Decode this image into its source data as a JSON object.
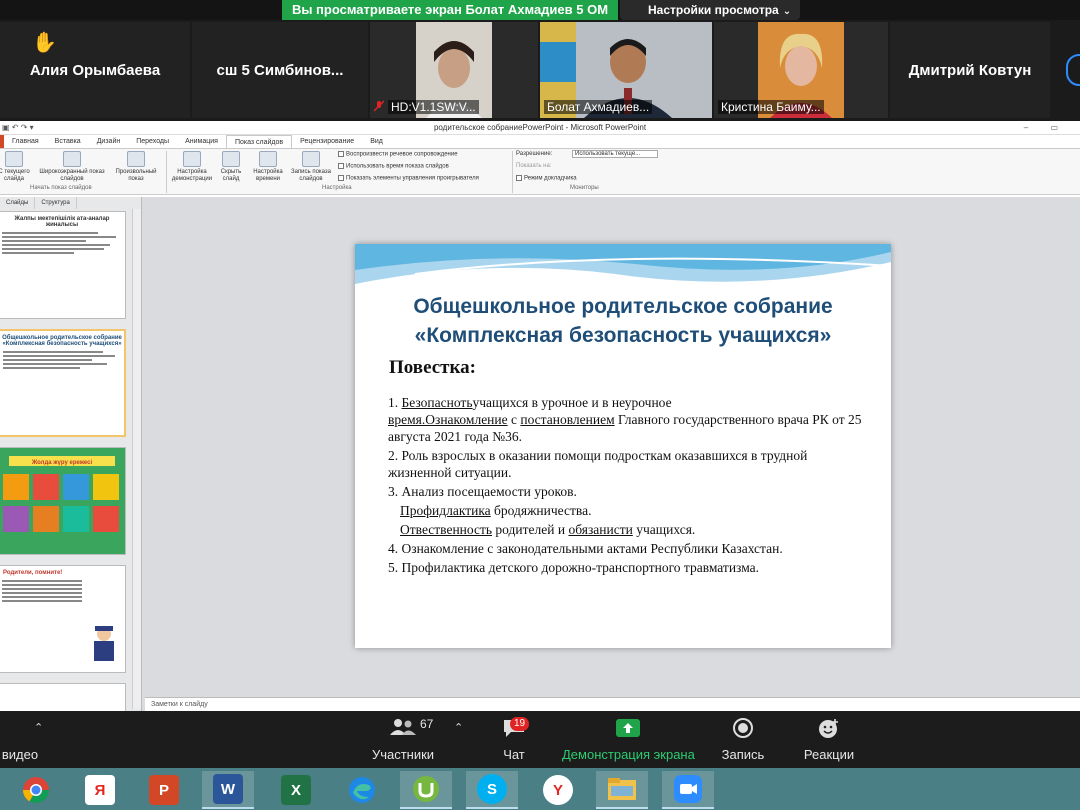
{
  "share_banner": {
    "viewing_text": "Вы просматриваете экран Болат Ахмадиев 5 ОМ",
    "settings_label": "Настройки просмотра"
  },
  "participants": [
    {
      "name": "Алия Орымбаева",
      "raised_hand": true
    },
    {
      "name": "сш 5  Симбинов...",
      "muted": true
    },
    {
      "name": "HD:V1.1SW:V...",
      "muted": true
    },
    {
      "name": "Болат Ахмадиев..."
    },
    {
      "name": "Кристина Баиму..."
    },
    {
      "name": "Дмитрий Ковтун"
    }
  ],
  "powerpoint": {
    "window_title": "родительское собраниePowerPoint - Microsoft PowerPoint",
    "tabs": [
      "Главная",
      "Вставка",
      "Дизайн",
      "Переходы",
      "Анимация",
      "Показ слайдов",
      "Рецензирование",
      "Вид"
    ],
    "active_tab": "Показ слайдов",
    "ribbon": {
      "b1": "С текущего слайда",
      "b2": "Широкоэкранный показ слайдов",
      "b3": "Произвольный показ",
      "group1": "Начать показ слайдов",
      "b4": "Настройка демонстрации",
      "b5": "Скрыть слайд",
      "b6": "Настройка времени",
      "b7": "Запись показа слайдов",
      "chk1": "Воспроизвести речевое сопровождение",
      "chk2": "Использовать время показа слайдов",
      "chk3": "Показать элементы управления проигрывателя",
      "group2": "Настройка",
      "res_label": "Разрешение:",
      "res_value": "Использовать текуще...",
      "show_on": "Показать на:",
      "presenter": "Режим докладчика",
      "group3": "Мониторы"
    },
    "thumb_tabs": [
      "Слайды",
      "Структура"
    ],
    "thumbs": [
      {
        "title": "Жалпы мектепішілік ата-аналар жиналысы"
      },
      {
        "title": "Общешкольное родительское собрание «Комплексная безопасность учащихся»"
      },
      {
        "title": "Жолда жүру ережесі"
      },
      {
        "title": "Родители, помните!"
      }
    ],
    "notes_placeholder": "Заметки к слайду"
  },
  "slide": {
    "title_line1": "Общешкольное родительское собрание",
    "title_line2": "«Комплексная безопасность учащихся»",
    "agenda_heading": "Повестка:",
    "item1_num": "1. ",
    "item1_a": "Безопасноть",
    "item1_b": "учащихся в урочное и в неурочное",
    "item1_c": "время.Ознакомление",
    "item1_d": " с ",
    "item1_e": "постановлением",
    "item1_f": " Главного государственного врача РК от 25 августа 2021 года №36.",
    "item2": "2. Роль взрослых в оказании помощи подросткам оказавшихся в трудной жизненной ситуации.",
    "item3": "3.  Анализ посещаемости уроков.",
    "item3_a": "Профидлактика",
    "item3_b": " бродяжничества.",
    "item3_c": "Отвественность",
    "item3_d": " родителей и ",
    "item3_e": "обязанисти",
    "item3_f": " учащихся.",
    "item4": "4. Ознакомление с законодательными актами Республики Казахстан.",
    "item5": "5. Профилактика детского дорожно-транспортного травматизма."
  },
  "toolbar": {
    "video_label": "видео",
    "participants_label": "Участники",
    "participants_count": "67",
    "chat_label": "Чат",
    "chat_badge": "19",
    "share_label": "Демонстрация экрана",
    "record_label": "Запись",
    "reactions_label": "Реакции"
  },
  "taskbar": {
    "apps": [
      "chrome-icon",
      "yandex-icon",
      "powerpoint-icon",
      "word-icon",
      "excel-icon",
      "edge-icon",
      "utorrent-icon",
      "skype-icon",
      "yandex-browser-icon",
      "explorer-icon",
      "zoom-icon"
    ],
    "yandex_letter": "Я",
    "word_letter": "W",
    "excel_letter": "X",
    "powerpoint_letter": "P",
    "skype_letter": "S",
    "yandex_browser_letter": "Y"
  },
  "colors": {
    "zoom_green": "#1fa44a",
    "slide_title": "#1f4e79",
    "taskbar": "#4a7f86"
  }
}
